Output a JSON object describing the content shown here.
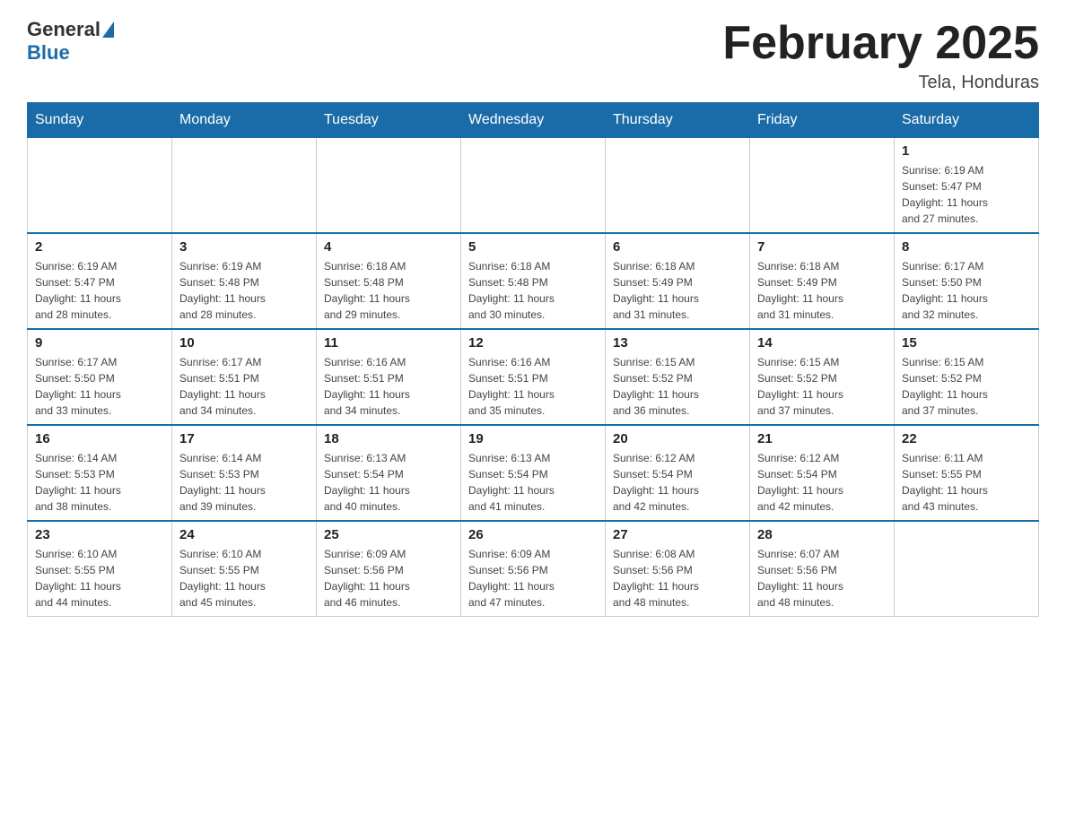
{
  "logo": {
    "general": "General",
    "blue": "Blue"
  },
  "header": {
    "title": "February 2025",
    "location": "Tela, Honduras"
  },
  "weekdays": [
    "Sunday",
    "Monday",
    "Tuesday",
    "Wednesday",
    "Thursday",
    "Friday",
    "Saturday"
  ],
  "weeks": [
    [
      {
        "day": "",
        "info": ""
      },
      {
        "day": "",
        "info": ""
      },
      {
        "day": "",
        "info": ""
      },
      {
        "day": "",
        "info": ""
      },
      {
        "day": "",
        "info": ""
      },
      {
        "day": "",
        "info": ""
      },
      {
        "day": "1",
        "info": "Sunrise: 6:19 AM\nSunset: 5:47 PM\nDaylight: 11 hours\nand 27 minutes."
      }
    ],
    [
      {
        "day": "2",
        "info": "Sunrise: 6:19 AM\nSunset: 5:47 PM\nDaylight: 11 hours\nand 28 minutes."
      },
      {
        "day": "3",
        "info": "Sunrise: 6:19 AM\nSunset: 5:48 PM\nDaylight: 11 hours\nand 28 minutes."
      },
      {
        "day": "4",
        "info": "Sunrise: 6:18 AM\nSunset: 5:48 PM\nDaylight: 11 hours\nand 29 minutes."
      },
      {
        "day": "5",
        "info": "Sunrise: 6:18 AM\nSunset: 5:48 PM\nDaylight: 11 hours\nand 30 minutes."
      },
      {
        "day": "6",
        "info": "Sunrise: 6:18 AM\nSunset: 5:49 PM\nDaylight: 11 hours\nand 31 minutes."
      },
      {
        "day": "7",
        "info": "Sunrise: 6:18 AM\nSunset: 5:49 PM\nDaylight: 11 hours\nand 31 minutes."
      },
      {
        "day": "8",
        "info": "Sunrise: 6:17 AM\nSunset: 5:50 PM\nDaylight: 11 hours\nand 32 minutes."
      }
    ],
    [
      {
        "day": "9",
        "info": "Sunrise: 6:17 AM\nSunset: 5:50 PM\nDaylight: 11 hours\nand 33 minutes."
      },
      {
        "day": "10",
        "info": "Sunrise: 6:17 AM\nSunset: 5:51 PM\nDaylight: 11 hours\nand 34 minutes."
      },
      {
        "day": "11",
        "info": "Sunrise: 6:16 AM\nSunset: 5:51 PM\nDaylight: 11 hours\nand 34 minutes."
      },
      {
        "day": "12",
        "info": "Sunrise: 6:16 AM\nSunset: 5:51 PM\nDaylight: 11 hours\nand 35 minutes."
      },
      {
        "day": "13",
        "info": "Sunrise: 6:15 AM\nSunset: 5:52 PM\nDaylight: 11 hours\nand 36 minutes."
      },
      {
        "day": "14",
        "info": "Sunrise: 6:15 AM\nSunset: 5:52 PM\nDaylight: 11 hours\nand 37 minutes."
      },
      {
        "day": "15",
        "info": "Sunrise: 6:15 AM\nSunset: 5:52 PM\nDaylight: 11 hours\nand 37 minutes."
      }
    ],
    [
      {
        "day": "16",
        "info": "Sunrise: 6:14 AM\nSunset: 5:53 PM\nDaylight: 11 hours\nand 38 minutes."
      },
      {
        "day": "17",
        "info": "Sunrise: 6:14 AM\nSunset: 5:53 PM\nDaylight: 11 hours\nand 39 minutes."
      },
      {
        "day": "18",
        "info": "Sunrise: 6:13 AM\nSunset: 5:54 PM\nDaylight: 11 hours\nand 40 minutes."
      },
      {
        "day": "19",
        "info": "Sunrise: 6:13 AM\nSunset: 5:54 PM\nDaylight: 11 hours\nand 41 minutes."
      },
      {
        "day": "20",
        "info": "Sunrise: 6:12 AM\nSunset: 5:54 PM\nDaylight: 11 hours\nand 42 minutes."
      },
      {
        "day": "21",
        "info": "Sunrise: 6:12 AM\nSunset: 5:54 PM\nDaylight: 11 hours\nand 42 minutes."
      },
      {
        "day": "22",
        "info": "Sunrise: 6:11 AM\nSunset: 5:55 PM\nDaylight: 11 hours\nand 43 minutes."
      }
    ],
    [
      {
        "day": "23",
        "info": "Sunrise: 6:10 AM\nSunset: 5:55 PM\nDaylight: 11 hours\nand 44 minutes."
      },
      {
        "day": "24",
        "info": "Sunrise: 6:10 AM\nSunset: 5:55 PM\nDaylight: 11 hours\nand 45 minutes."
      },
      {
        "day": "25",
        "info": "Sunrise: 6:09 AM\nSunset: 5:56 PM\nDaylight: 11 hours\nand 46 minutes."
      },
      {
        "day": "26",
        "info": "Sunrise: 6:09 AM\nSunset: 5:56 PM\nDaylight: 11 hours\nand 47 minutes."
      },
      {
        "day": "27",
        "info": "Sunrise: 6:08 AM\nSunset: 5:56 PM\nDaylight: 11 hours\nand 48 minutes."
      },
      {
        "day": "28",
        "info": "Sunrise: 6:07 AM\nSunset: 5:56 PM\nDaylight: 11 hours\nand 48 minutes."
      },
      {
        "day": "",
        "info": ""
      }
    ]
  ]
}
